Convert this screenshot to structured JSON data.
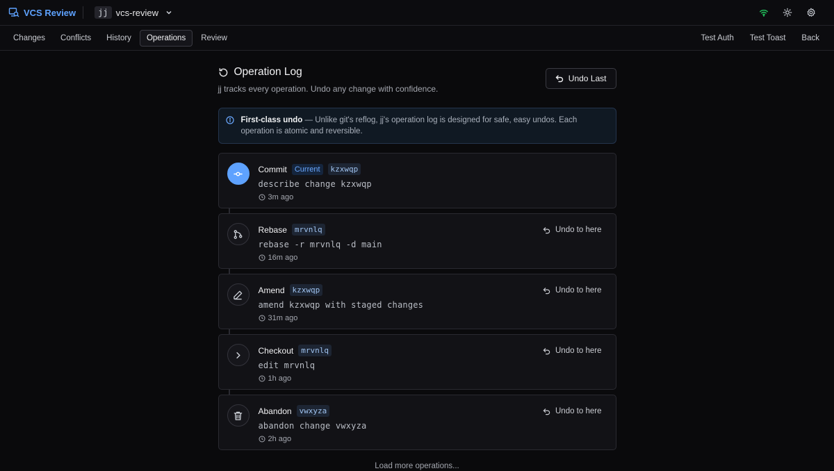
{
  "app": {
    "name": "VCS Review",
    "repo_badge": "jj",
    "repo_name": "vcs-review",
    "icons": [
      "wifi-icon",
      "sun-icon",
      "gear-icon"
    ]
  },
  "nav": {
    "tabs": [
      "Changes",
      "Conflicts",
      "History",
      "Operations",
      "Review"
    ],
    "active": "Operations",
    "right": [
      "Test Auth",
      "Test Toast",
      "Back"
    ]
  },
  "page": {
    "title": "Operation Log",
    "subtitle": "jj tracks every operation. Undo any change with confidence.",
    "undo_last": "Undo Last"
  },
  "info": {
    "strong": "First-class undo",
    "text": " — Unlike git's reflog, jj's operation log is designed for safe, easy undos. Each operation is atomic and reversible."
  },
  "operations": [
    {
      "type": "Commit",
      "current_label": "Current",
      "id": "kzxwqp",
      "desc": "describe change kzxwqp",
      "time": "3m ago",
      "icon": "commit-icon"
    },
    {
      "type": "Rebase",
      "id": "mrvnlq",
      "desc": "rebase -r mrvnlq -d main",
      "time": "16m ago",
      "undo": "Undo to here",
      "icon": "git-branch-icon"
    },
    {
      "type": "Amend",
      "id": "kzxwqp",
      "desc": "amend kzxwqp with staged changes",
      "time": "31m ago",
      "undo": "Undo to here",
      "icon": "pencil-icon"
    },
    {
      "type": "Checkout",
      "id": "mrvnlq",
      "desc": "edit mrvnlq",
      "time": "1h ago",
      "undo": "Undo to here",
      "icon": "chevron-right-icon"
    },
    {
      "type": "Abandon",
      "id": "vwxyza",
      "desc": "abandon change vwxyza",
      "time": "2h ago",
      "undo": "Undo to here",
      "icon": "trash-icon"
    }
  ],
  "load_more": "Load more operations...",
  "colors": {
    "accent": "#5ea2ff",
    "background": "#0a0a0c",
    "card": "#121216",
    "info_bg": "#101923",
    "wifi": "#22c55e"
  }
}
